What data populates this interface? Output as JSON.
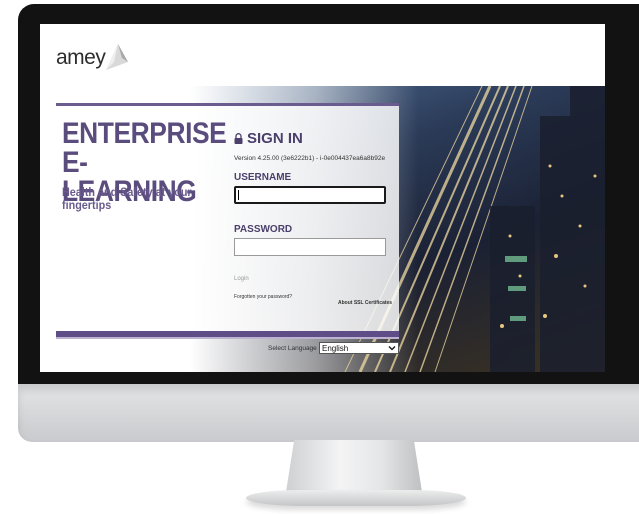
{
  "brand": {
    "logo_text": "amey"
  },
  "hero": {
    "title_line1": "ENTERPRISE",
    "title_line2": "E-LEARNING",
    "subtitle": "Health and Safety at your fingertips"
  },
  "signin": {
    "heading": "SIGN IN",
    "version": "Version 4.25.00 (3e6222b1) - i-0e004437ea6a8b92e",
    "username_label": "USERNAME",
    "username_value": "",
    "password_label": "PASSWORD",
    "password_value": "",
    "login_label": "Login",
    "forgot_label": "Forgotten your password?",
    "ssl_label": "About SSL Certificates"
  },
  "language": {
    "label": "Select Language",
    "selected": "English"
  },
  "colors": {
    "brand_purple": "#5a4c7d",
    "bezel": "#121212",
    "chin": "#d6d7d9"
  },
  "icons": [
    "lock-icon",
    "chevron-down-icon",
    "amey-logo-mark"
  ]
}
